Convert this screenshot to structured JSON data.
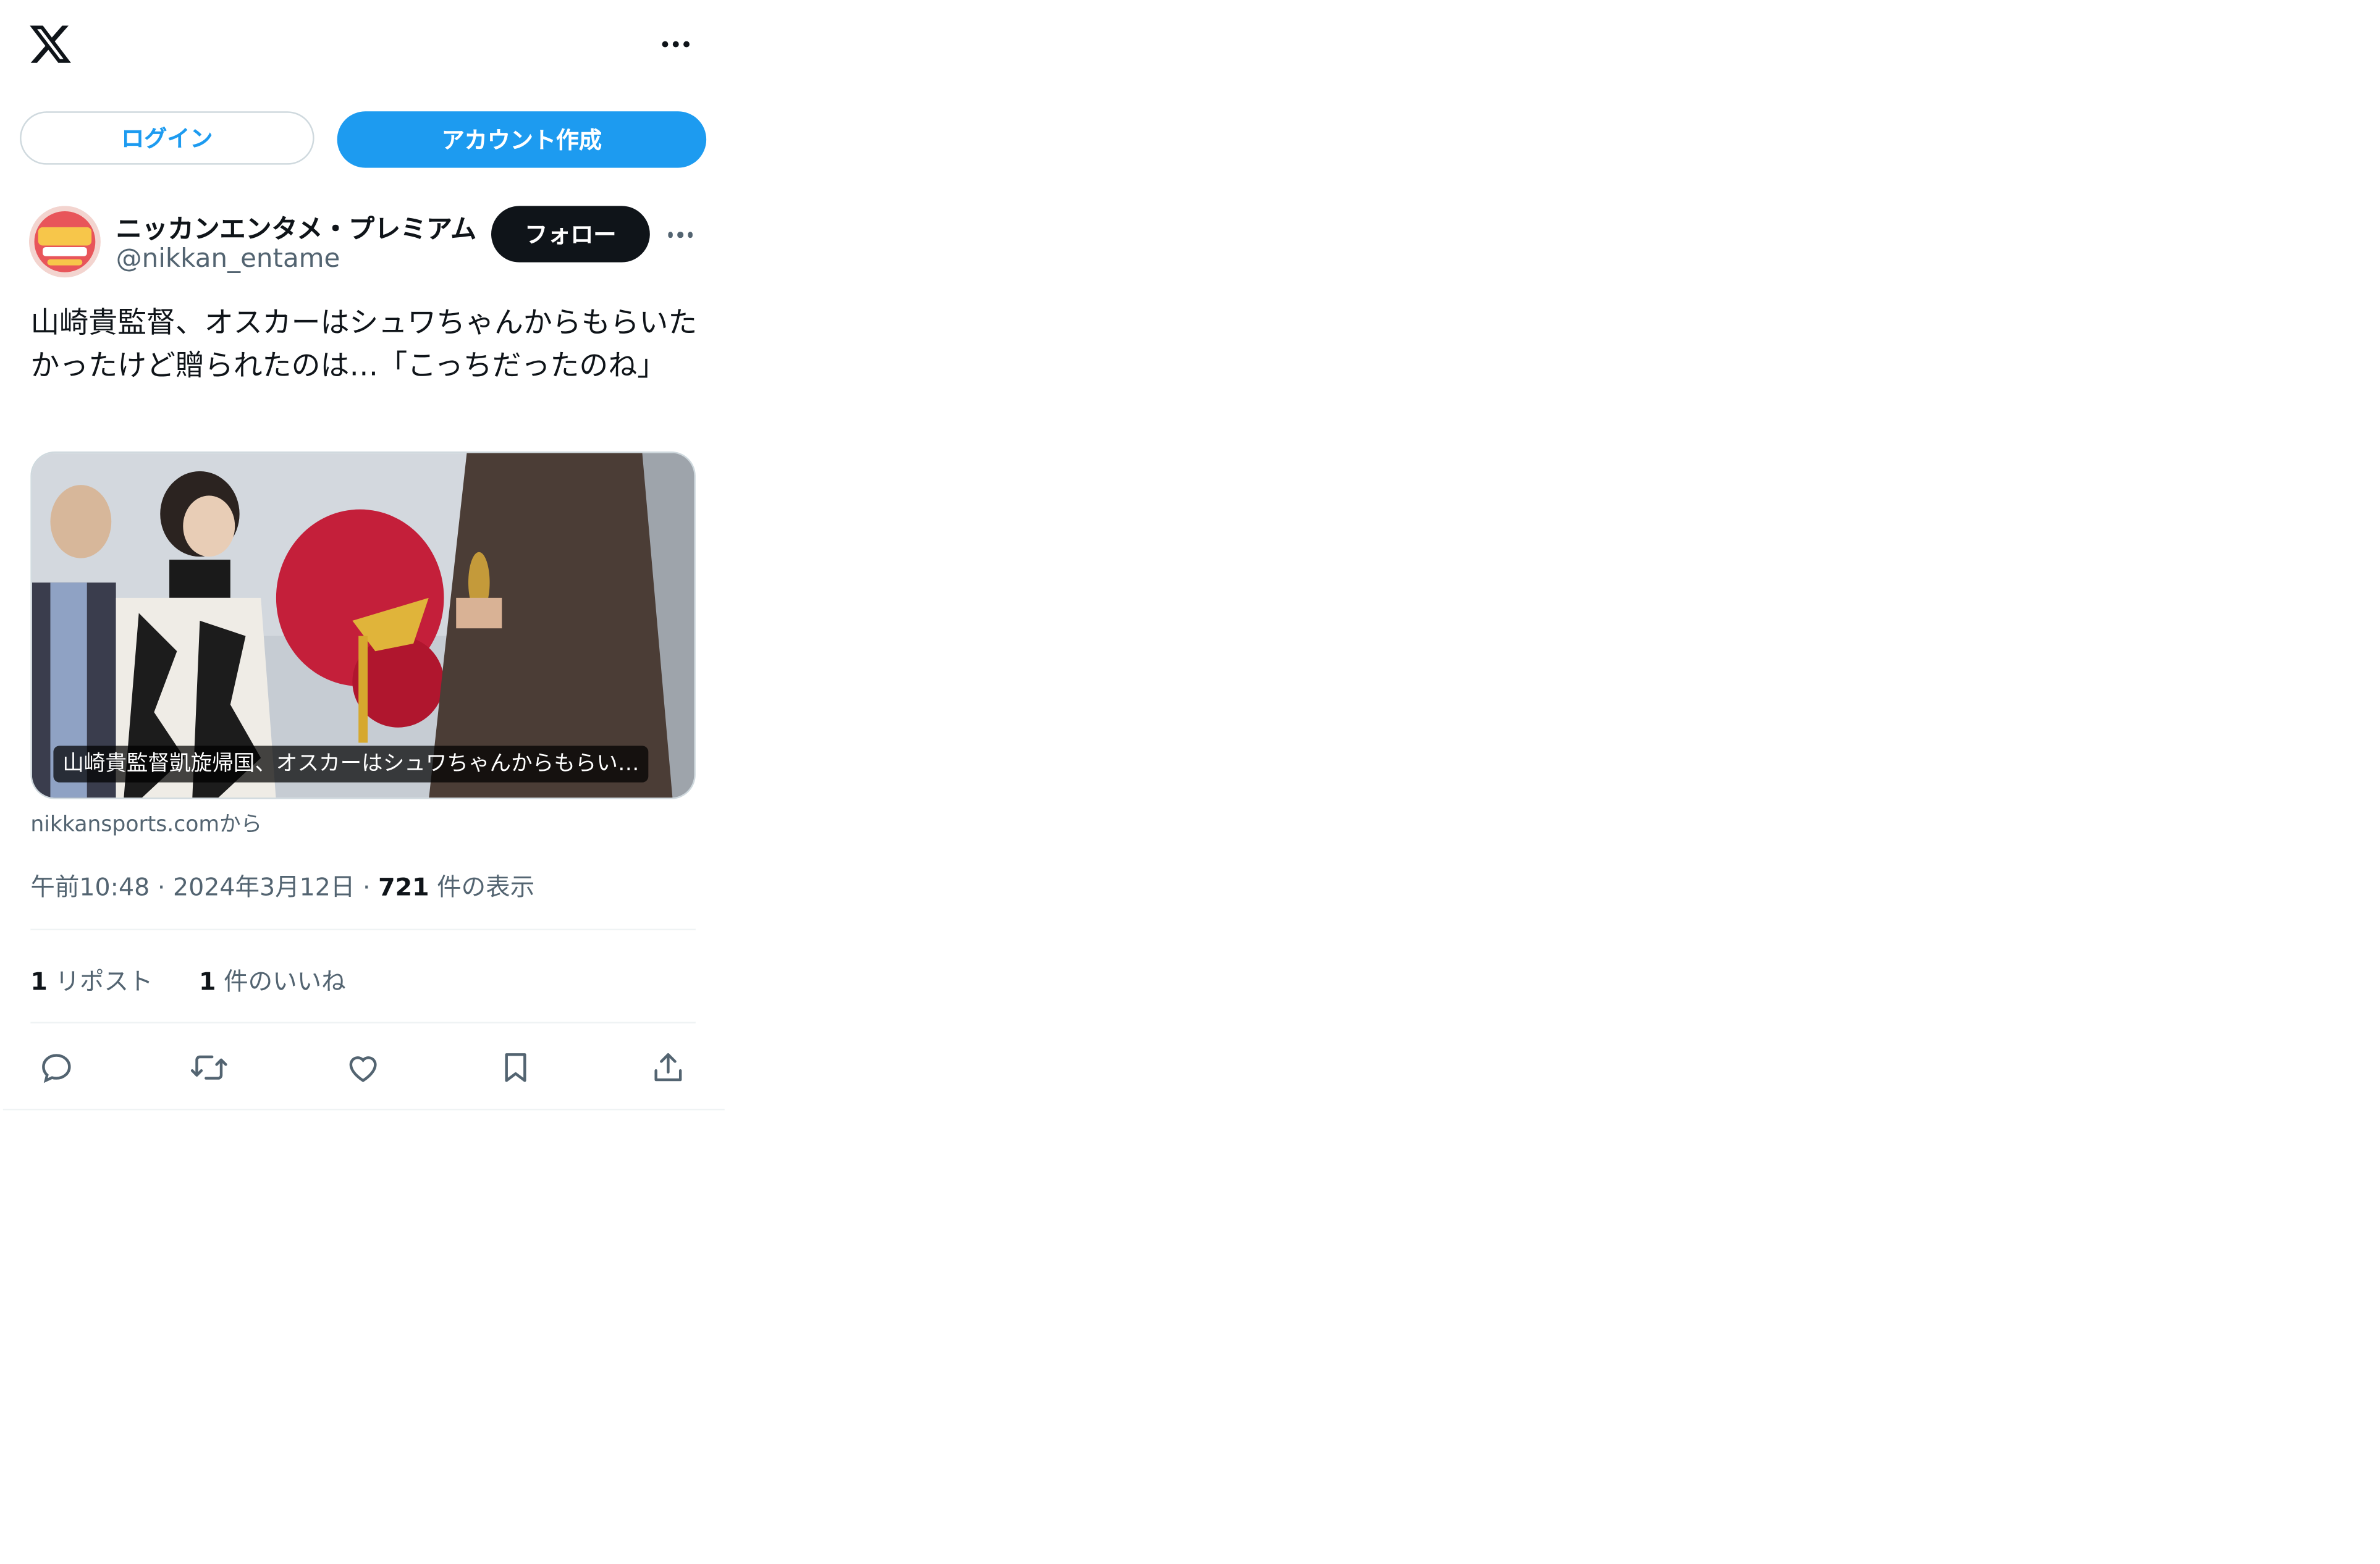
{
  "header": {
    "logo_icon": "x-logo-icon",
    "more_icon": "more-icon"
  },
  "auth": {
    "login_label": "ログイン",
    "signup_label": "アカウント作成"
  },
  "author": {
    "name": "ニッカンエンタメ・プレミアム",
    "handle": "@nikkan_entame",
    "follow_label": "フォロー"
  },
  "tweet": {
    "text": "山崎貴監督、オスカーはシュワちゃんからもらいたかったけど贈られたのは…「こっちだったのね」"
  },
  "card": {
    "caption": "山崎貴監督凱旋帰国、オスカーはシュワちゃんからもらい…",
    "source": "nikkansports.comから"
  },
  "meta": {
    "time": "午前10:48",
    "date": "2024年3月12日",
    "views_count": "721",
    "views_label": "件の表示"
  },
  "stats": {
    "reposts_count": "1",
    "reposts_label": "リポスト",
    "likes_count": "1",
    "likes_label": "件のいいね"
  },
  "colors": {
    "accent": "#1d9bf0",
    "text": "#0f1419",
    "muted": "#536471",
    "border": "#cfd9de"
  }
}
